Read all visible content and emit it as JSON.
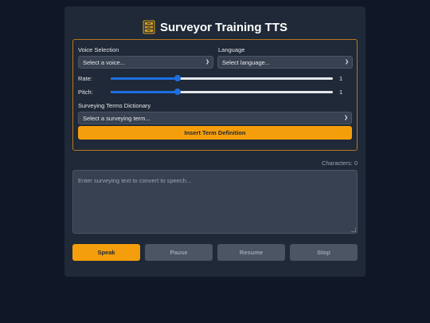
{
  "app": {
    "title": "Surveyor Training TTS",
    "title_icon": "card-file-box-icon"
  },
  "settings": {
    "voice_label": "Voice Selection",
    "voice_placeholder": "Select a voice...",
    "language_label": "Language",
    "language_placeholder": "Select language...",
    "rate_label": "Rate:",
    "rate_value": "1",
    "rate_fraction": 0.3,
    "pitch_label": "Pitch:",
    "pitch_value": "1",
    "pitch_fraction": 0.3,
    "terms_label": "Surveying Terms Dictionary",
    "terms_placeholder": "Select a surveying term...",
    "insert_button": "Insert Term Definition"
  },
  "editor": {
    "char_count": "Characters: 0",
    "placeholder": "Enter surveying text to convert to speech..."
  },
  "controls": {
    "speak": "Speak",
    "pause": "Pause",
    "resume": "Resume",
    "stop": "Stop"
  },
  "colors": {
    "accent": "#f59e0b",
    "slider": "#1d6fe0",
    "card": "#1f2937",
    "background": "#101827"
  }
}
